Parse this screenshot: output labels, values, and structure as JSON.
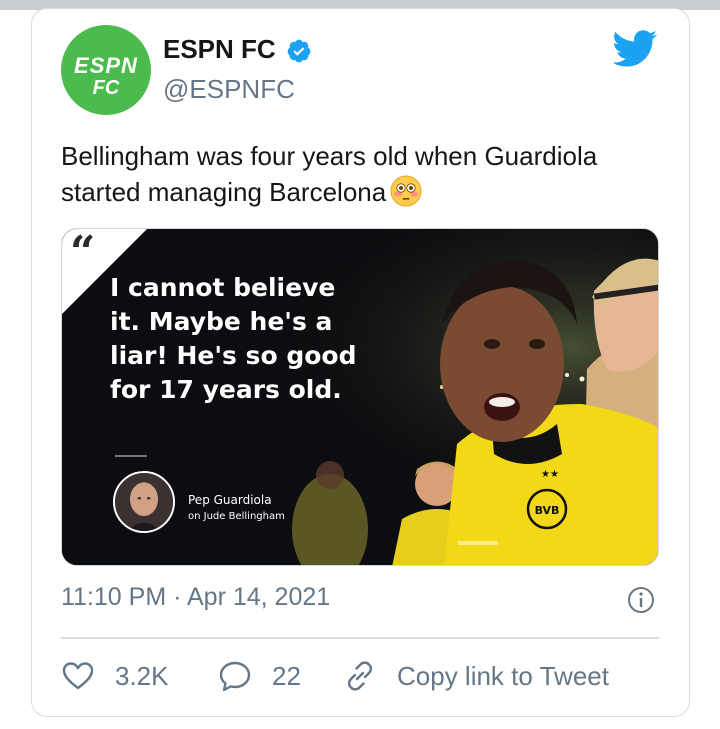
{
  "tweet": {
    "display_name": "ESPN FC",
    "handle": "@ESPNFC",
    "avatar_text_top": "ESPN",
    "avatar_text_bottom": "FC",
    "text": "Bellingham was four years old when Guardiola started managing Barcelona",
    "emoji": "flushed-face-emoji",
    "timestamp": "11:10 PM · Apr 14, 2021"
  },
  "media": {
    "quote_mark": "66",
    "quote": "I cannot believe it. Maybe he's a liar! He's so good for 17 years old.",
    "speaker_name": "Pep Guardiola",
    "speaker_context": "on Jude Bellingham"
  },
  "actions": {
    "like_count": "3.2K",
    "reply_count": "22",
    "copy_link_label": "Copy link to Tweet"
  },
  "colors": {
    "avatar_green": "#4cbb4e",
    "twitter_blue": "#1da1f2",
    "secondary_text": "#657786",
    "kit_yellow": "#f2d816"
  }
}
